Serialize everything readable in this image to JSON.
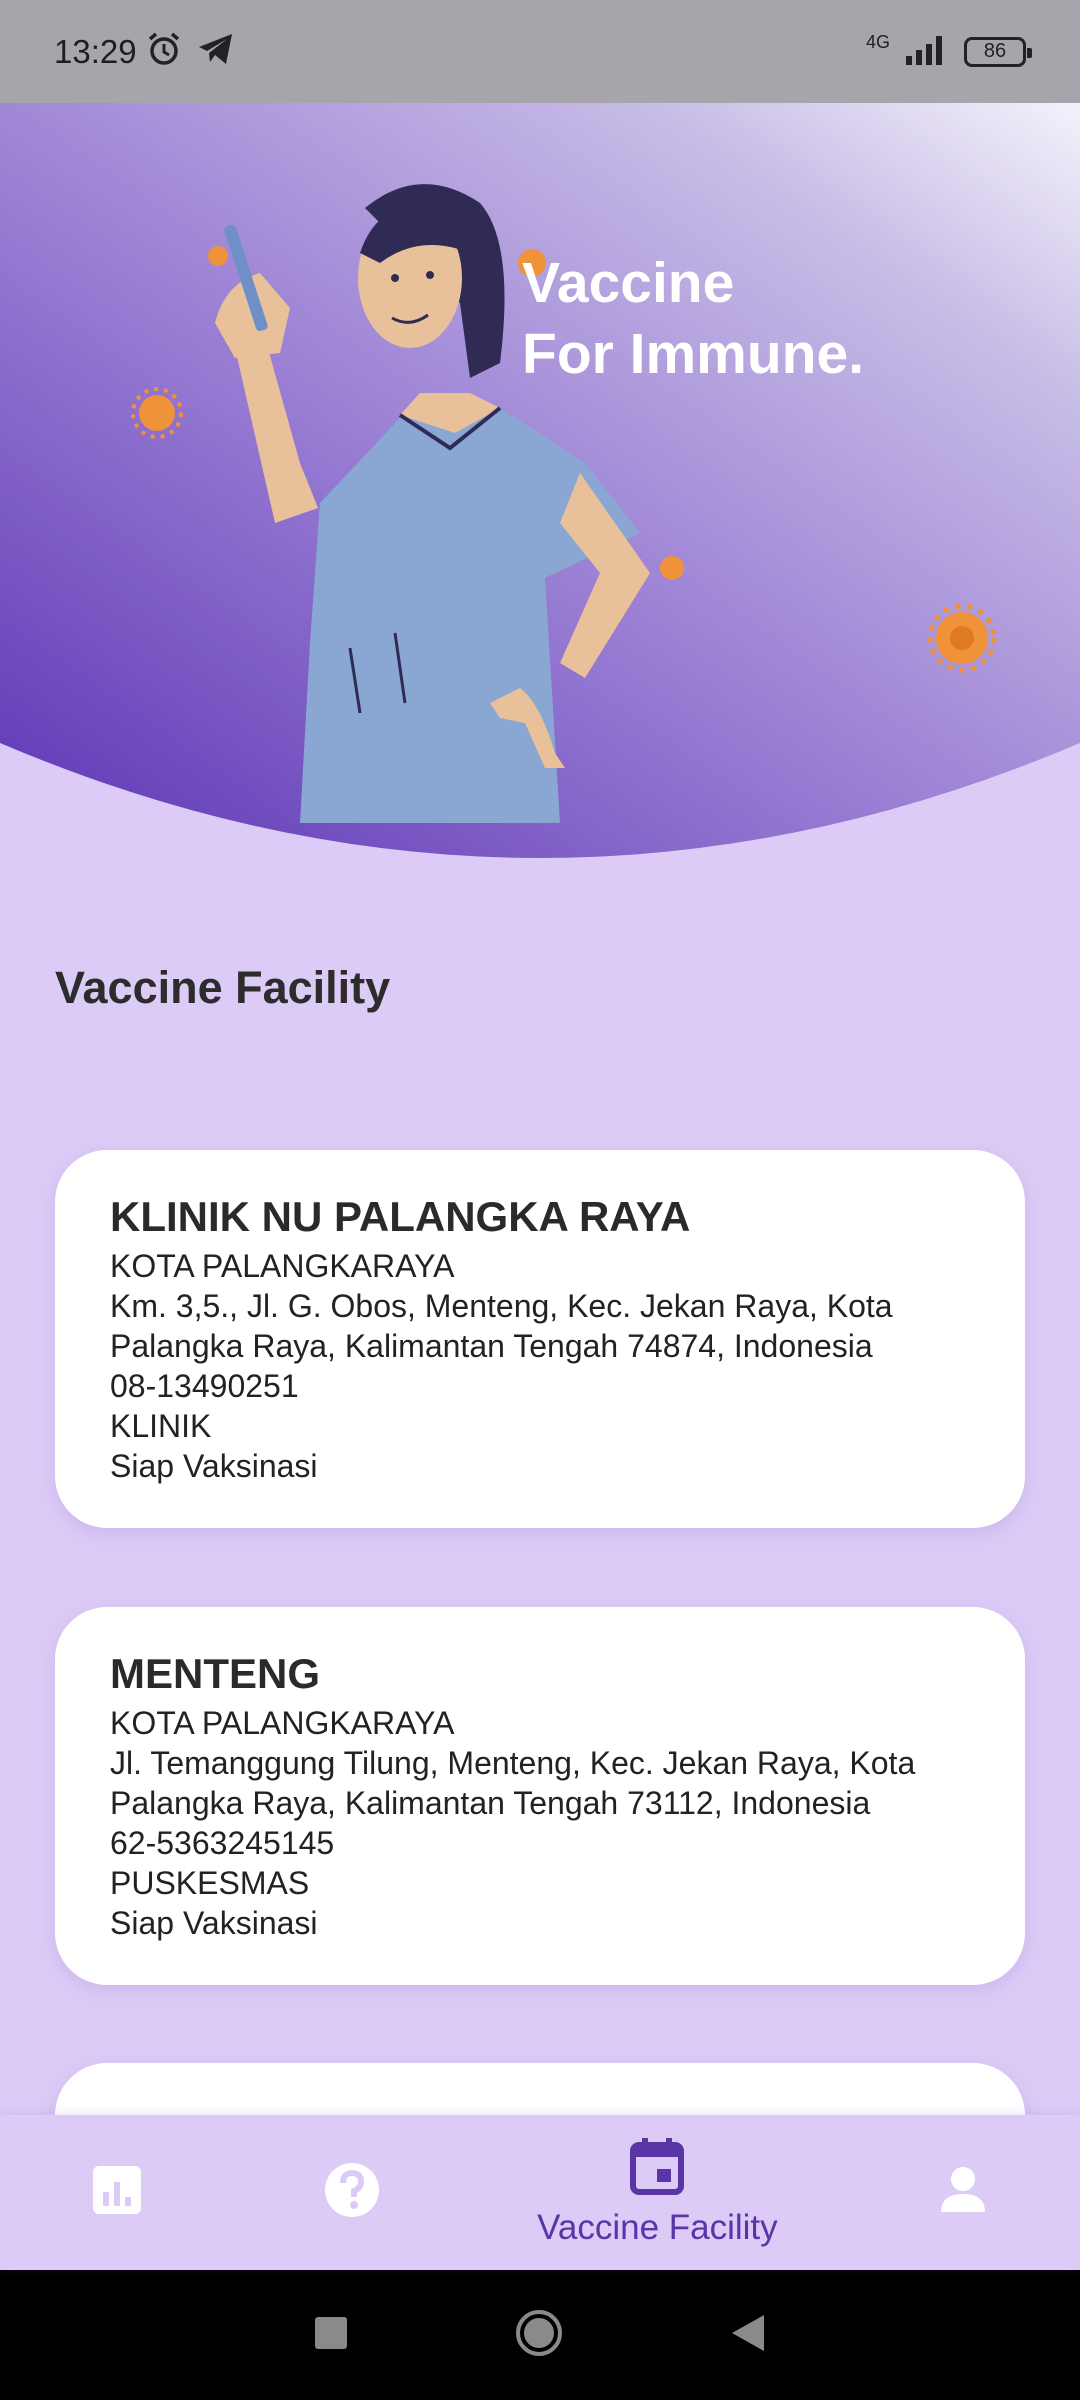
{
  "status_bar": {
    "time": "13:29",
    "network": "4G",
    "battery": "86"
  },
  "hero": {
    "title_line1": "Vaccine",
    "title_line2": "For Immune."
  },
  "section_title": "Vaccine Facility",
  "facilities": [
    {
      "name": "KLINIK NU PALANGKA RAYA",
      "city": "KOTA PALANGKARAYA",
      "address_line1": "Km. 3,5., Jl. G. Obos, Menteng, Kec. Jekan Raya, Kota",
      "address_line2": "Palangka Raya, Kalimantan Tengah 74874, Indonesia",
      "phone": "08-13490251",
      "type": "KLINIK",
      "status": "Siap Vaksinasi"
    },
    {
      "name": "MENTENG",
      "city": "KOTA PALANGKARAYA",
      "address_line1": "Jl. Temanggung Tilung, Menteng, Kec. Jekan Raya, Kota",
      "address_line2": "Palangka Raya, Kalimantan Tengah 73112, Indonesia",
      "phone": "62-5363245145",
      "type": "PUSKESMAS",
      "status": "Siap Vaksinasi"
    }
  ],
  "bottom_nav": {
    "items": [
      {
        "icon": "stats-icon"
      },
      {
        "icon": "help-icon"
      },
      {
        "icon": "calendar-icon",
        "label": "Vaccine Facility",
        "active": true
      },
      {
        "icon": "profile-icon"
      }
    ]
  },
  "colors": {
    "accent": "#5a35a6",
    "background": "#dccbf6",
    "card": "#ffffff"
  }
}
